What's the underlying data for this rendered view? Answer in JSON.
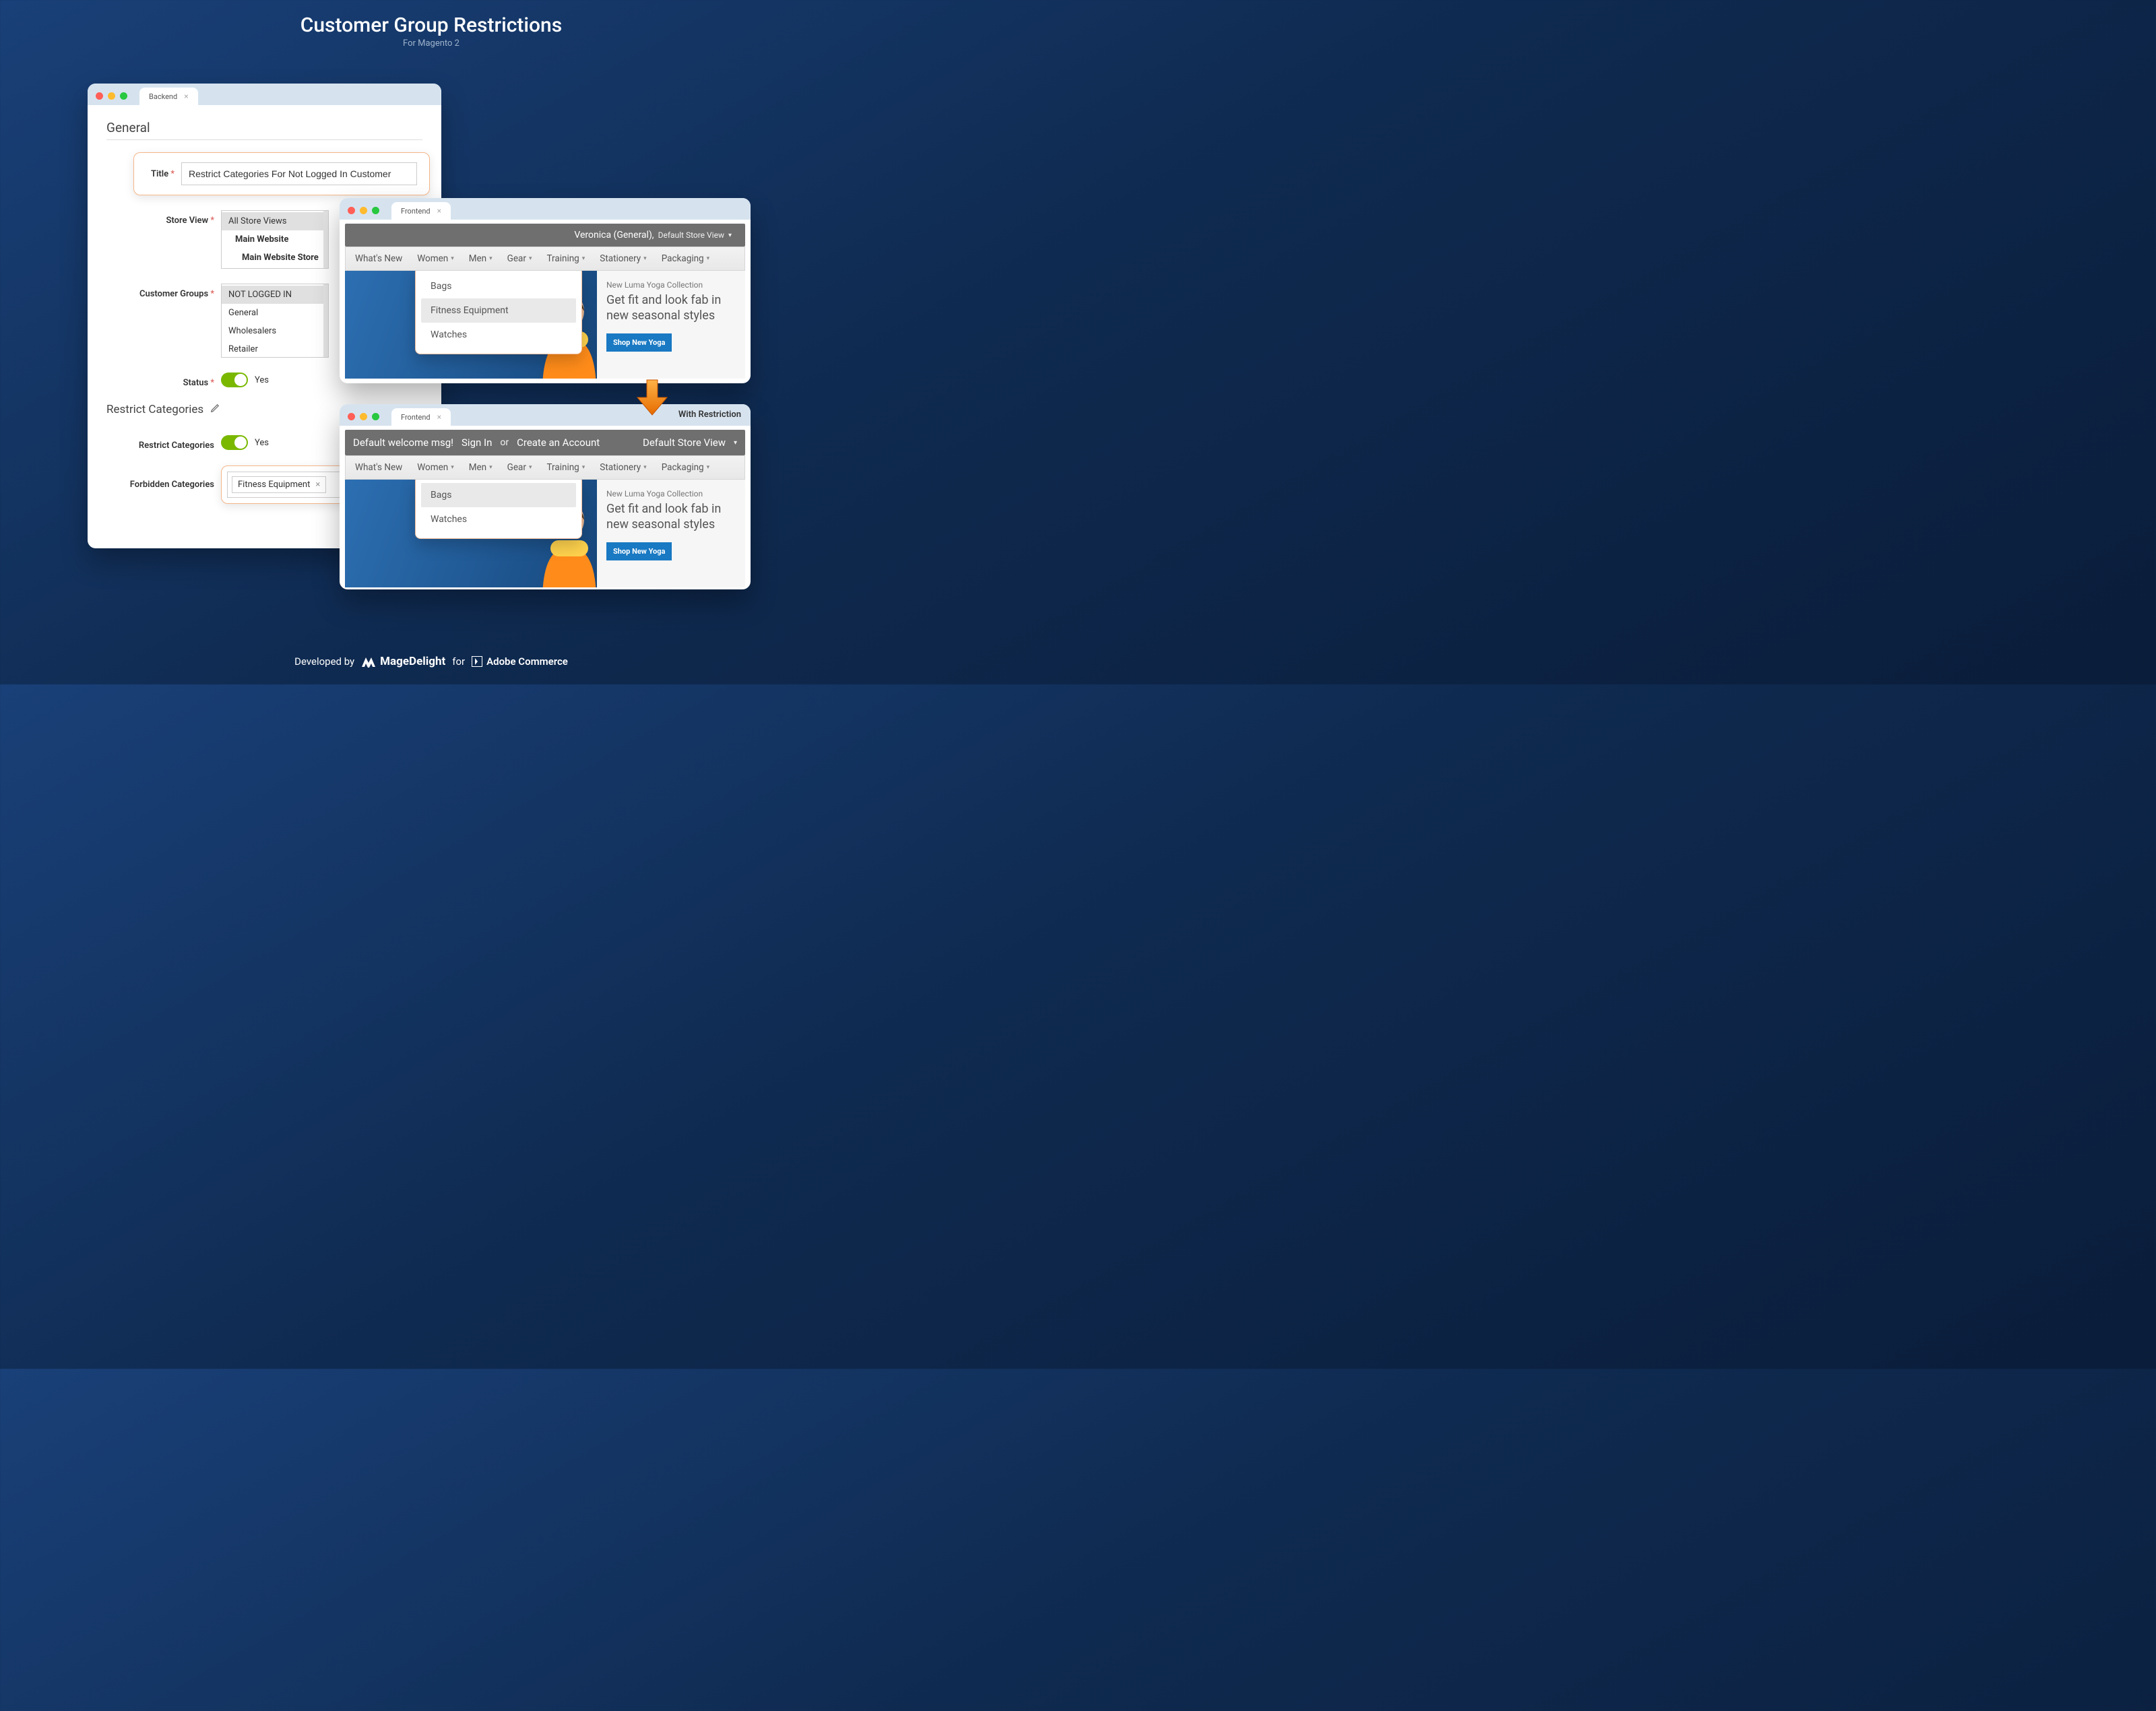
{
  "hero": {
    "title": "Customer Group Restrictions",
    "subtitle": "For Magento 2"
  },
  "backend": {
    "tab": "Backend",
    "sections": {
      "general": "General",
      "restrict": "Restrict Categories"
    },
    "labels": {
      "title": "Title",
      "store_view": "Store View",
      "customer_groups": "Customer Groups",
      "status": "Status",
      "restrict_categories": "Restrict Categories",
      "forbidden": "Forbidden Categories"
    },
    "title_value": "Restrict Categories For Not Logged In Customer",
    "store_views": [
      "All Store Views",
      "Main Website",
      "Main Website Store"
    ],
    "store_selected": 0,
    "groups": [
      "NOT LOGGED IN",
      "General",
      "Wholesalers",
      "Retailer"
    ],
    "groups_selected": 0,
    "status_value": "Yes",
    "restrict_value": "Yes",
    "forbidden_chip": "Fitness Equipment"
  },
  "frontend_common": {
    "tab": "Frontend",
    "nav": [
      "What's New",
      "Women",
      "Men",
      "Gear",
      "Training",
      "Stationery",
      "Packaging"
    ],
    "promo": {
      "eyebrow": "New Luma Yoga Collection",
      "headline1": "Get fit and look fab in",
      "headline2": "new seasonal styles",
      "cta": "Shop New Yoga"
    }
  },
  "frontend1": {
    "user": "Veronica (General),",
    "store": "Default Store View",
    "dropdown": [
      "Bags",
      "Fitness Equipment",
      "Watches"
    ],
    "dropdown_selected": 1
  },
  "frontend2": {
    "banner_tag": "With Restriction",
    "welcome": "Default welcome msg!",
    "signin": "Sign In",
    "or": "or",
    "create": "Create an Account",
    "store": "Default Store View",
    "dropdown": [
      "Bags",
      "Watches"
    ],
    "dropdown_selected": 0
  },
  "footer": {
    "dev": "Developed by",
    "brand": "MageDelight",
    "for": "for",
    "adobe": "Adobe Commerce"
  }
}
